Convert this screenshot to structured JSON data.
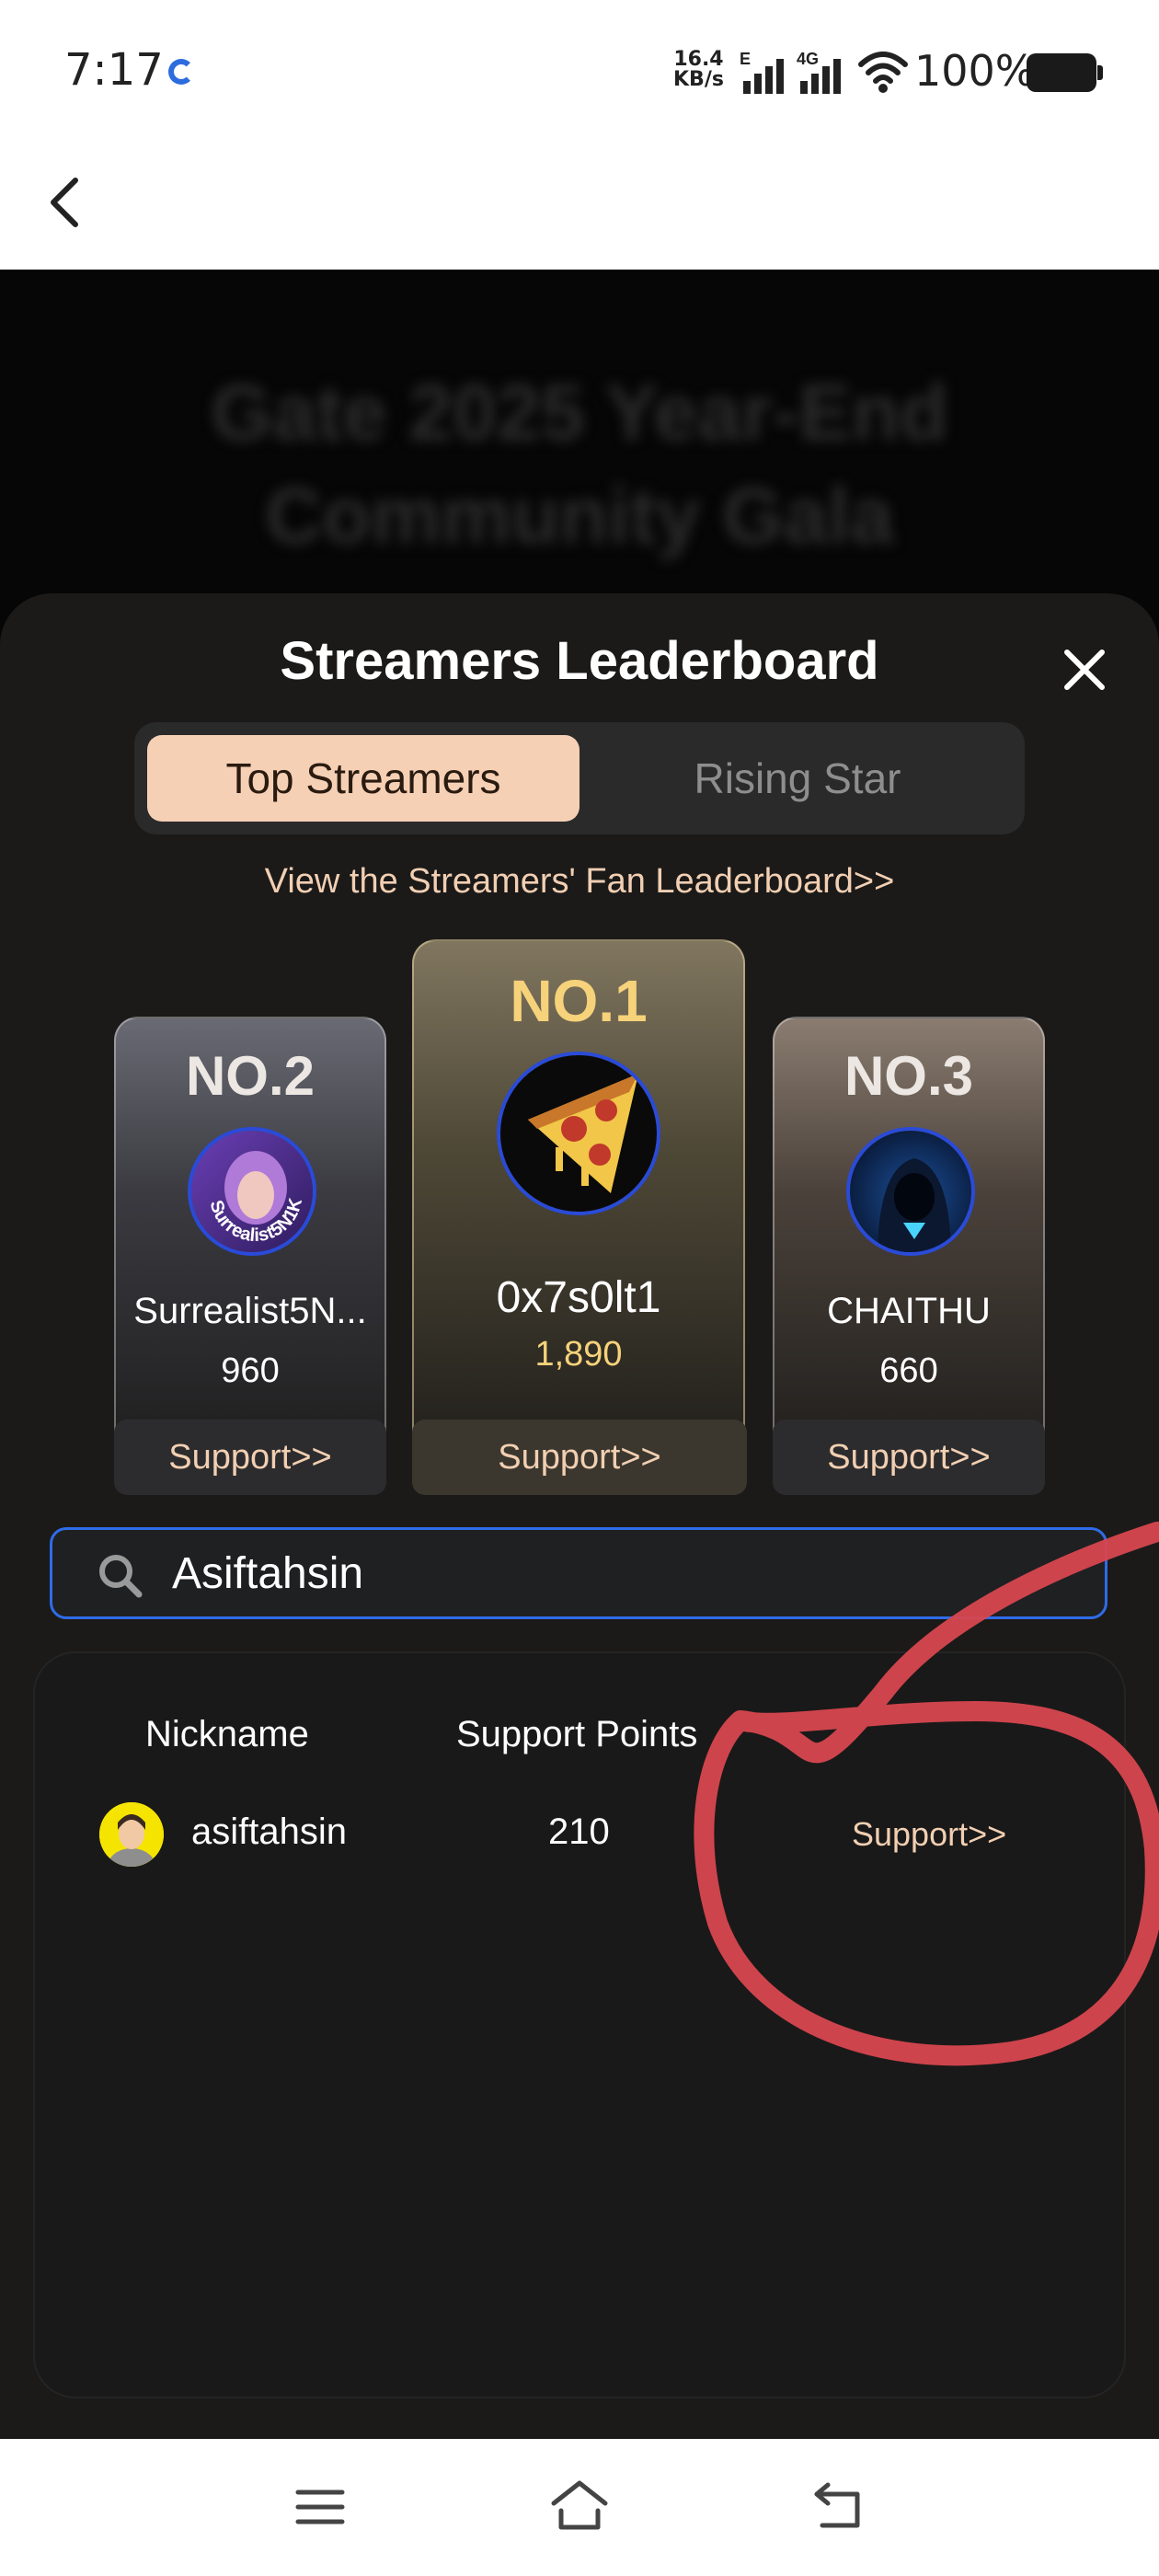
{
  "status_bar": {
    "time": "7:17",
    "net_speed_value": "16.4",
    "net_speed_unit": "KB/s",
    "sim1_label": "E",
    "sim2_label": "4G",
    "battery": "100%"
  },
  "page": {
    "background_title": "Gate 2025 Year-End Community Gala"
  },
  "leaderboard": {
    "title": "Streamers Leaderboard",
    "tabs": [
      {
        "label": "Top Streamers",
        "active": true
      },
      {
        "label": "Rising Star",
        "active": false
      }
    ],
    "fan_link": "View the Streamers' Fan Leaderboard>>",
    "podium": [
      {
        "rank": "NO.2",
        "name": "Surrealist5N...",
        "points": "960",
        "support": "Support>>"
      },
      {
        "rank": "NO.1",
        "name": "0x7s0lt1",
        "points": "1,890",
        "support": "Support>>"
      },
      {
        "rank": "NO.3",
        "name": "CHAITHU",
        "points": "660",
        "support": "Support>>"
      }
    ],
    "avatar_text_no2": "Surrealist5N1K",
    "search": {
      "value": "Asiftahsin"
    },
    "table": {
      "headers": [
        "Nickname",
        "Support Points"
      ],
      "rows": [
        {
          "name": "asiftahsin",
          "points": "210",
          "support": "Support>>"
        }
      ]
    }
  },
  "colors": {
    "accent": "#f6d0b5",
    "gold": "#f6d27a",
    "search_border": "#2f6ce8",
    "annotation": "#d8474f"
  }
}
